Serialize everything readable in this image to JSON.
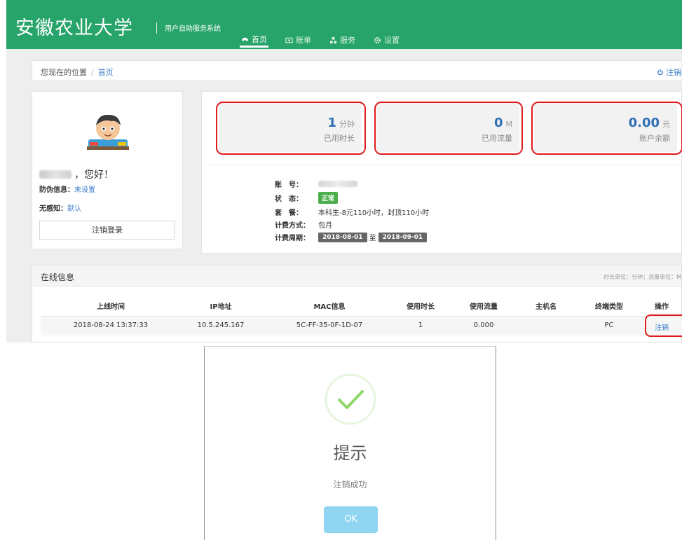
{
  "header": {
    "brand": "安徽农业大学",
    "subtitle": "用户自助服务系统",
    "nav": [
      {
        "label": "首页",
        "icon": "dashboard-icon",
        "active": true
      },
      {
        "label": "账单",
        "icon": "bill-icon",
        "active": false
      },
      {
        "label": "服务",
        "icon": "service-icon",
        "active": false
      },
      {
        "label": "设置",
        "icon": "gear-icon",
        "active": false
      }
    ]
  },
  "breadcrumb": {
    "prefix": "您现在的位置",
    "separator": "/",
    "current": "首页",
    "logout": "注销"
  },
  "profile": {
    "greeting": "，您好！",
    "anti_fraud_label": "防伪信息：",
    "anti_fraud_value": "未设置",
    "seamless_label": "无感知：",
    "seamless_value": "默认",
    "logout_button": "注销登录"
  },
  "stats": [
    {
      "value": "1",
      "unit": "分钟",
      "label": "已用时长"
    },
    {
      "value": "0",
      "unit": "M",
      "label": "已用流量"
    },
    {
      "value": "0.00",
      "unit": "元",
      "label": "账户余额"
    }
  ],
  "account": {
    "account_label": "账　号：",
    "status_label": "状　态：",
    "status_value": "正常",
    "plan_label": "套　餐：",
    "plan_value": "本科生-8元110小时，封顶110小时",
    "billing_label": "计费方式：",
    "billing_value": "包月",
    "period_label": "计费周期：",
    "period_start": "2018-08-01",
    "period_to": "至",
    "period_end": "2018-09-01"
  },
  "online": {
    "title": "在线信息",
    "unit_note": "时长单位：分钟；流量单位：M",
    "columns": [
      "上线时间",
      "IP地址",
      "MAC信息",
      "使用时长",
      "使用流量",
      "主机名",
      "终端类型",
      "操作"
    ],
    "rows": [
      {
        "login_time": "2018-08-24 13:37:33",
        "ip": "10.5.245.167",
        "mac": "5C-FF-35-0F-1D-07",
        "duration": "1",
        "traffic": "0.000",
        "host": "",
        "terminal": "PC",
        "action": "注销"
      }
    ]
  },
  "dialog": {
    "title": "提示",
    "message": "注销成功",
    "ok": "OK",
    "colors": {
      "check": "#8fd66a",
      "ring": "#e8f5dd",
      "button": "#8fd4f1"
    }
  },
  "colors": {
    "header": "#26a469",
    "annotation": "#e01b1b",
    "link": "#3a7dc9"
  }
}
